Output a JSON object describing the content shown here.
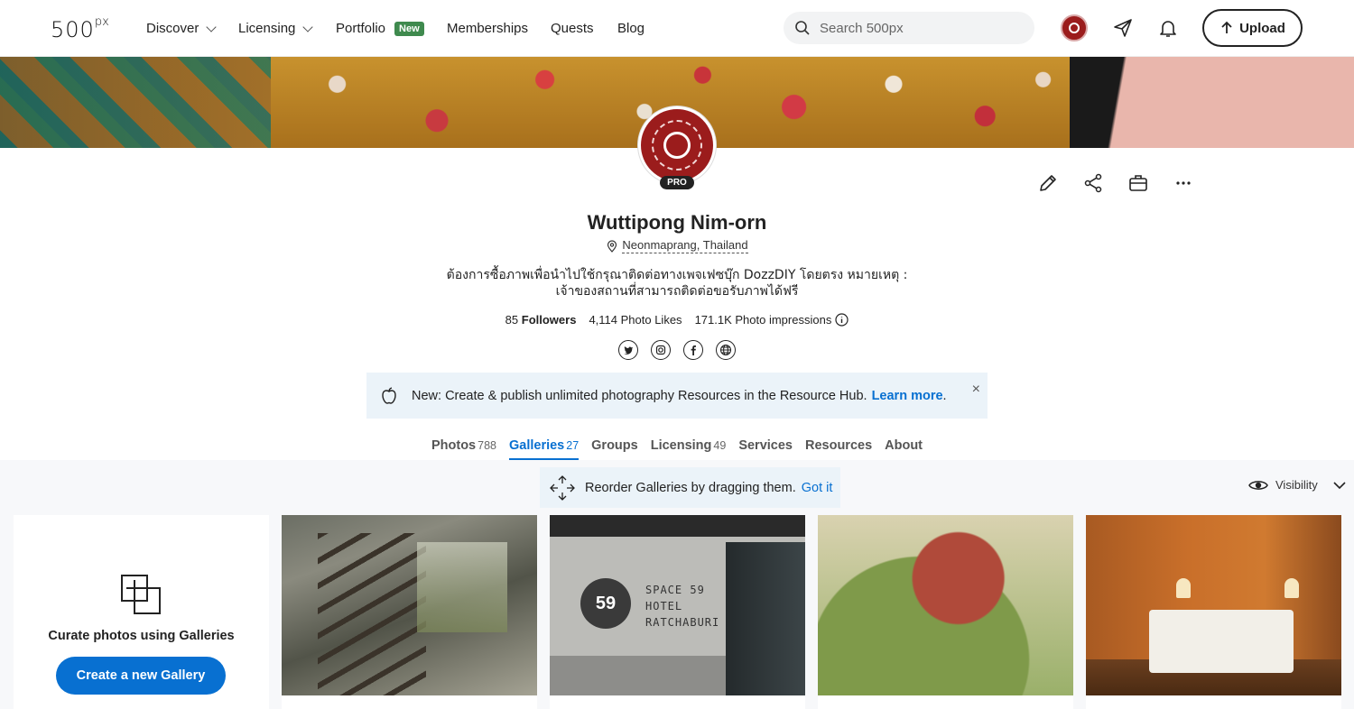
{
  "nav": {
    "logo_main": "500",
    "logo_sup": "px",
    "items": [
      {
        "label": "Discover",
        "dropdown": true
      },
      {
        "label": "Licensing",
        "dropdown": true
      },
      {
        "label": "Portfolio",
        "badge": "New"
      },
      {
        "label": "Memberships"
      },
      {
        "label": "Quests"
      },
      {
        "label": "Blog"
      }
    ],
    "search_placeholder": "Search 500px",
    "upload_label": "Upload"
  },
  "profile": {
    "badge": "PRO",
    "name": "Wuttipong Nim-orn",
    "location": "Neonmaprang, Thailand",
    "bio_line1": "ต้องการซื้อภาพเพื่อนำไปใช้กรุณาติดต่อทางเพจเฟซบุ๊ก DozzDIY โดยตรง หมายเหตุ :",
    "bio_line2": "เจ้าของสถานที่สามารถติดต่อขอรับภาพได้ฟรี",
    "followers_count": "85",
    "followers_label": "Followers",
    "photo_likes": "4,114 Photo Likes",
    "impressions": "171.1K Photo impressions",
    "social_icons": [
      "twitter-icon",
      "instagram-icon",
      "facebook-icon",
      "website-icon"
    ]
  },
  "notice": {
    "text": "New: Create & publish unlimited photography Resources in the Resource Hub.",
    "link": "Learn more",
    "trail": ".",
    "close": "×"
  },
  "tabs": [
    {
      "label": "Photos",
      "count": "788",
      "active": false
    },
    {
      "label": "Galleries",
      "count": "27",
      "active": true
    },
    {
      "label": "Groups",
      "count": "",
      "active": false
    },
    {
      "label": "Licensing",
      "count": "49",
      "active": false
    },
    {
      "label": "Services",
      "count": "",
      "active": false
    },
    {
      "label": "Resources",
      "count": "",
      "active": false
    },
    {
      "label": "About",
      "count": "",
      "active": false
    }
  ],
  "galleries": {
    "reorder_text": "Reorder Galleries by dragging them.",
    "reorder_link": "Got it",
    "visibility_label": "Visibility",
    "new_card_label": "Curate photos using Galleries",
    "new_card_button": "Create a new Gallery",
    "hotel_number": "59",
    "hotel_sign": [
      "SPACE 59",
      "HOTEL",
      "RATCHABURI"
    ]
  },
  "colors": {
    "accent": "#0870d1",
    "new_badge": "#3f8a4e",
    "notice_bg": "#ebf3f9",
    "avatar": "#9b1c1c"
  }
}
